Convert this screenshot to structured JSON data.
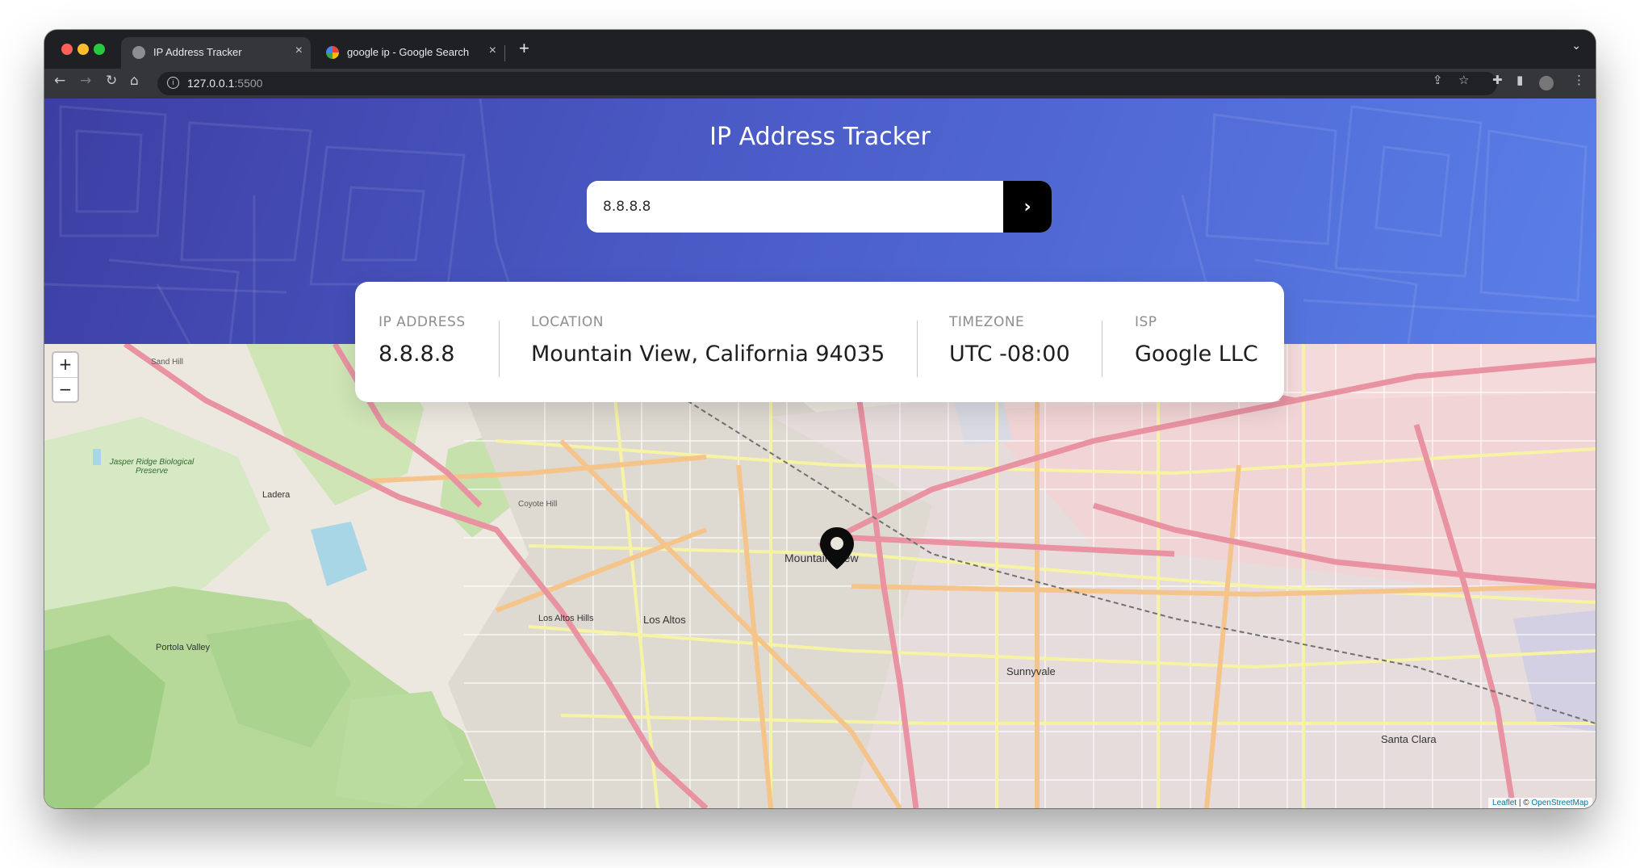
{
  "browser": {
    "tabs": [
      {
        "title": "IP Address Tracker",
        "active": true
      },
      {
        "title": "google ip - Google Search",
        "active": false
      }
    ],
    "address_bar": {
      "host": "127.0.0.1",
      "port": ":5500"
    }
  },
  "header": {
    "title": "IP Address Tracker",
    "search_value": "8.8.8.8",
    "submit_glyph": "›"
  },
  "info": {
    "ip_label": "IP ADDRESS",
    "ip_value": "8.8.8.8",
    "location_label": "LOCATION",
    "location_value": "Mountain View, California 94035",
    "timezone_label": "TIMEZONE",
    "timezone_value": "UTC -08:00",
    "isp_label": "ISP",
    "isp_value": "Google LLC"
  },
  "map": {
    "zoom_in": "+",
    "zoom_out": "−",
    "attribution": {
      "leaflet": "Leaflet",
      "separator": " | © ",
      "osm": "OpenStreetMap"
    },
    "labels": {
      "mountain_view": "Mountain View",
      "los_altos": "Los Altos",
      "los_altos_hills": "Los Altos Hills",
      "sunnyvale": "Sunnyvale",
      "santa_clara": "Santa Clara",
      "ladera": "Ladera",
      "portola_valley": "Portola Valley",
      "jasper_ridge": "Jasper Ridge Biological Preserve",
      "coyote_hill": "Coyote Hill",
      "sand_hill": "Sand Hill"
    }
  },
  "colors": {
    "header_start": "#3d3ea3",
    "header_end": "#5a7fe8",
    "motorway": "#e892a2",
    "primary_road": "#fcd6a4",
    "park": "#c8e6a8"
  }
}
